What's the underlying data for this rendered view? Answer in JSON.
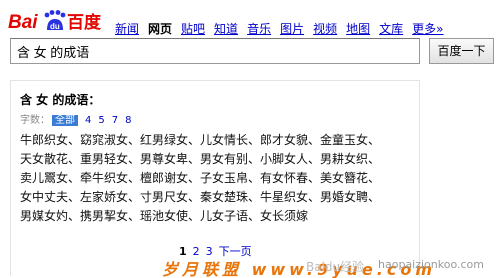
{
  "header": {
    "logo_text": "Baidu百度",
    "nav": [
      {
        "label": "新闻",
        "active": false
      },
      {
        "label": "网页",
        "active": true
      },
      {
        "label": "贴吧",
        "active": false
      },
      {
        "label": "知道",
        "active": false
      },
      {
        "label": "音乐",
        "active": false
      },
      {
        "label": "图片",
        "active": false
      },
      {
        "label": "视频",
        "active": false
      },
      {
        "label": "地图",
        "active": false
      },
      {
        "label": "文库",
        "active": false
      },
      {
        "label": "更多»",
        "active": false
      }
    ]
  },
  "search": {
    "query": "含 女 的成语",
    "button_label": "百度一下"
  },
  "result": {
    "title": "含 女 的成语：",
    "filter_label": "字数：",
    "filter_options": [
      "全部",
      "4",
      "5",
      "7",
      "8"
    ],
    "selected_filter": "全部",
    "words": [
      "牛郎织女、窈窕淑女、红男绿女、儿女情长、郎才女貌、金童玉女、",
      "天女散花、重男轻女、男尊女卑、男女有别、小脚女人、男耕女织、",
      "卖儿鬻女、牵牛织女、檀郎谢女、子女玉帛、有女怀春、美女簪花、",
      "女中丈夫、左家娇女、寸男尺女、秦女楚珠、牛星织女、男婚女聘、",
      "男媒女妁、携男挈女、瑶池女使、儿女子语、女长须嫁"
    ],
    "pager": {
      "current": "1",
      "pages": [
        "2",
        "3"
      ],
      "next_label": "下一页"
    }
  },
  "watermark": {
    "left": "岁月联盟 www.9yue.com",
    "middle": "Baidu经验",
    "right": "haopaizionkoo.com"
  },
  "colors": {
    "link": "#0000cc",
    "logo_blue": "#2932e1",
    "logo_red": "#e10602",
    "selected_filter_bg": "#3a7bd5",
    "watermark_orange": "#e8760c"
  }
}
